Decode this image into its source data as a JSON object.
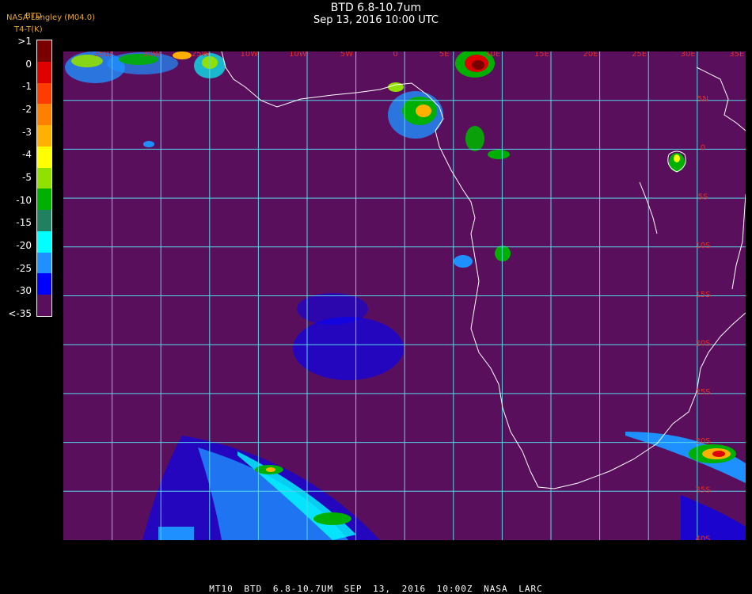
{
  "title": {
    "main": "BTD 6.8-10.7um",
    "sub": "Sep 13, 2016 10:00 UTC"
  },
  "credit": {
    "org": "NASA Langley (M04.0)",
    "btd": "BTD",
    "units": "T4-T(K)"
  },
  "legend": {
    "labels": [
      ">1",
      "0",
      "-1",
      "-2",
      "-3",
      "-4",
      "-5",
      "-10",
      "-15",
      "-20",
      "-25",
      "-30",
      "<-35"
    ],
    "colors": [
      "#7a0000",
      "#e00000",
      "#ff3c00",
      "#ff8000",
      "#ffb000",
      "#ffff00",
      "#90e000",
      "#00b000",
      "#208060",
      "#00ffff",
      "#1e90ff",
      "#0000ff",
      "#5a0f5c"
    ]
  },
  "map": {
    "ocean_color": "#5a0f5c",
    "grid_color": "#55d8e8",
    "coast_color": "#ffffff",
    "label_color": "#e0302a",
    "lon_labels": [
      "35W",
      "30W",
      "25W",
      "10W",
      "10W",
      "5W",
      "0",
      "5E",
      "10E",
      "15E",
      "20E",
      "25E",
      "30E",
      "35E"
    ],
    "lat_labels": [
      "5N",
      "0",
      "5S",
      "10S",
      "15S",
      "20S",
      "25S",
      "30S",
      "35S",
      "40S"
    ]
  },
  "footer": {
    "text": "MT10 BTD 6.8-10.7UM SEP 13, 2016 10:00Z NASA LARC"
  }
}
